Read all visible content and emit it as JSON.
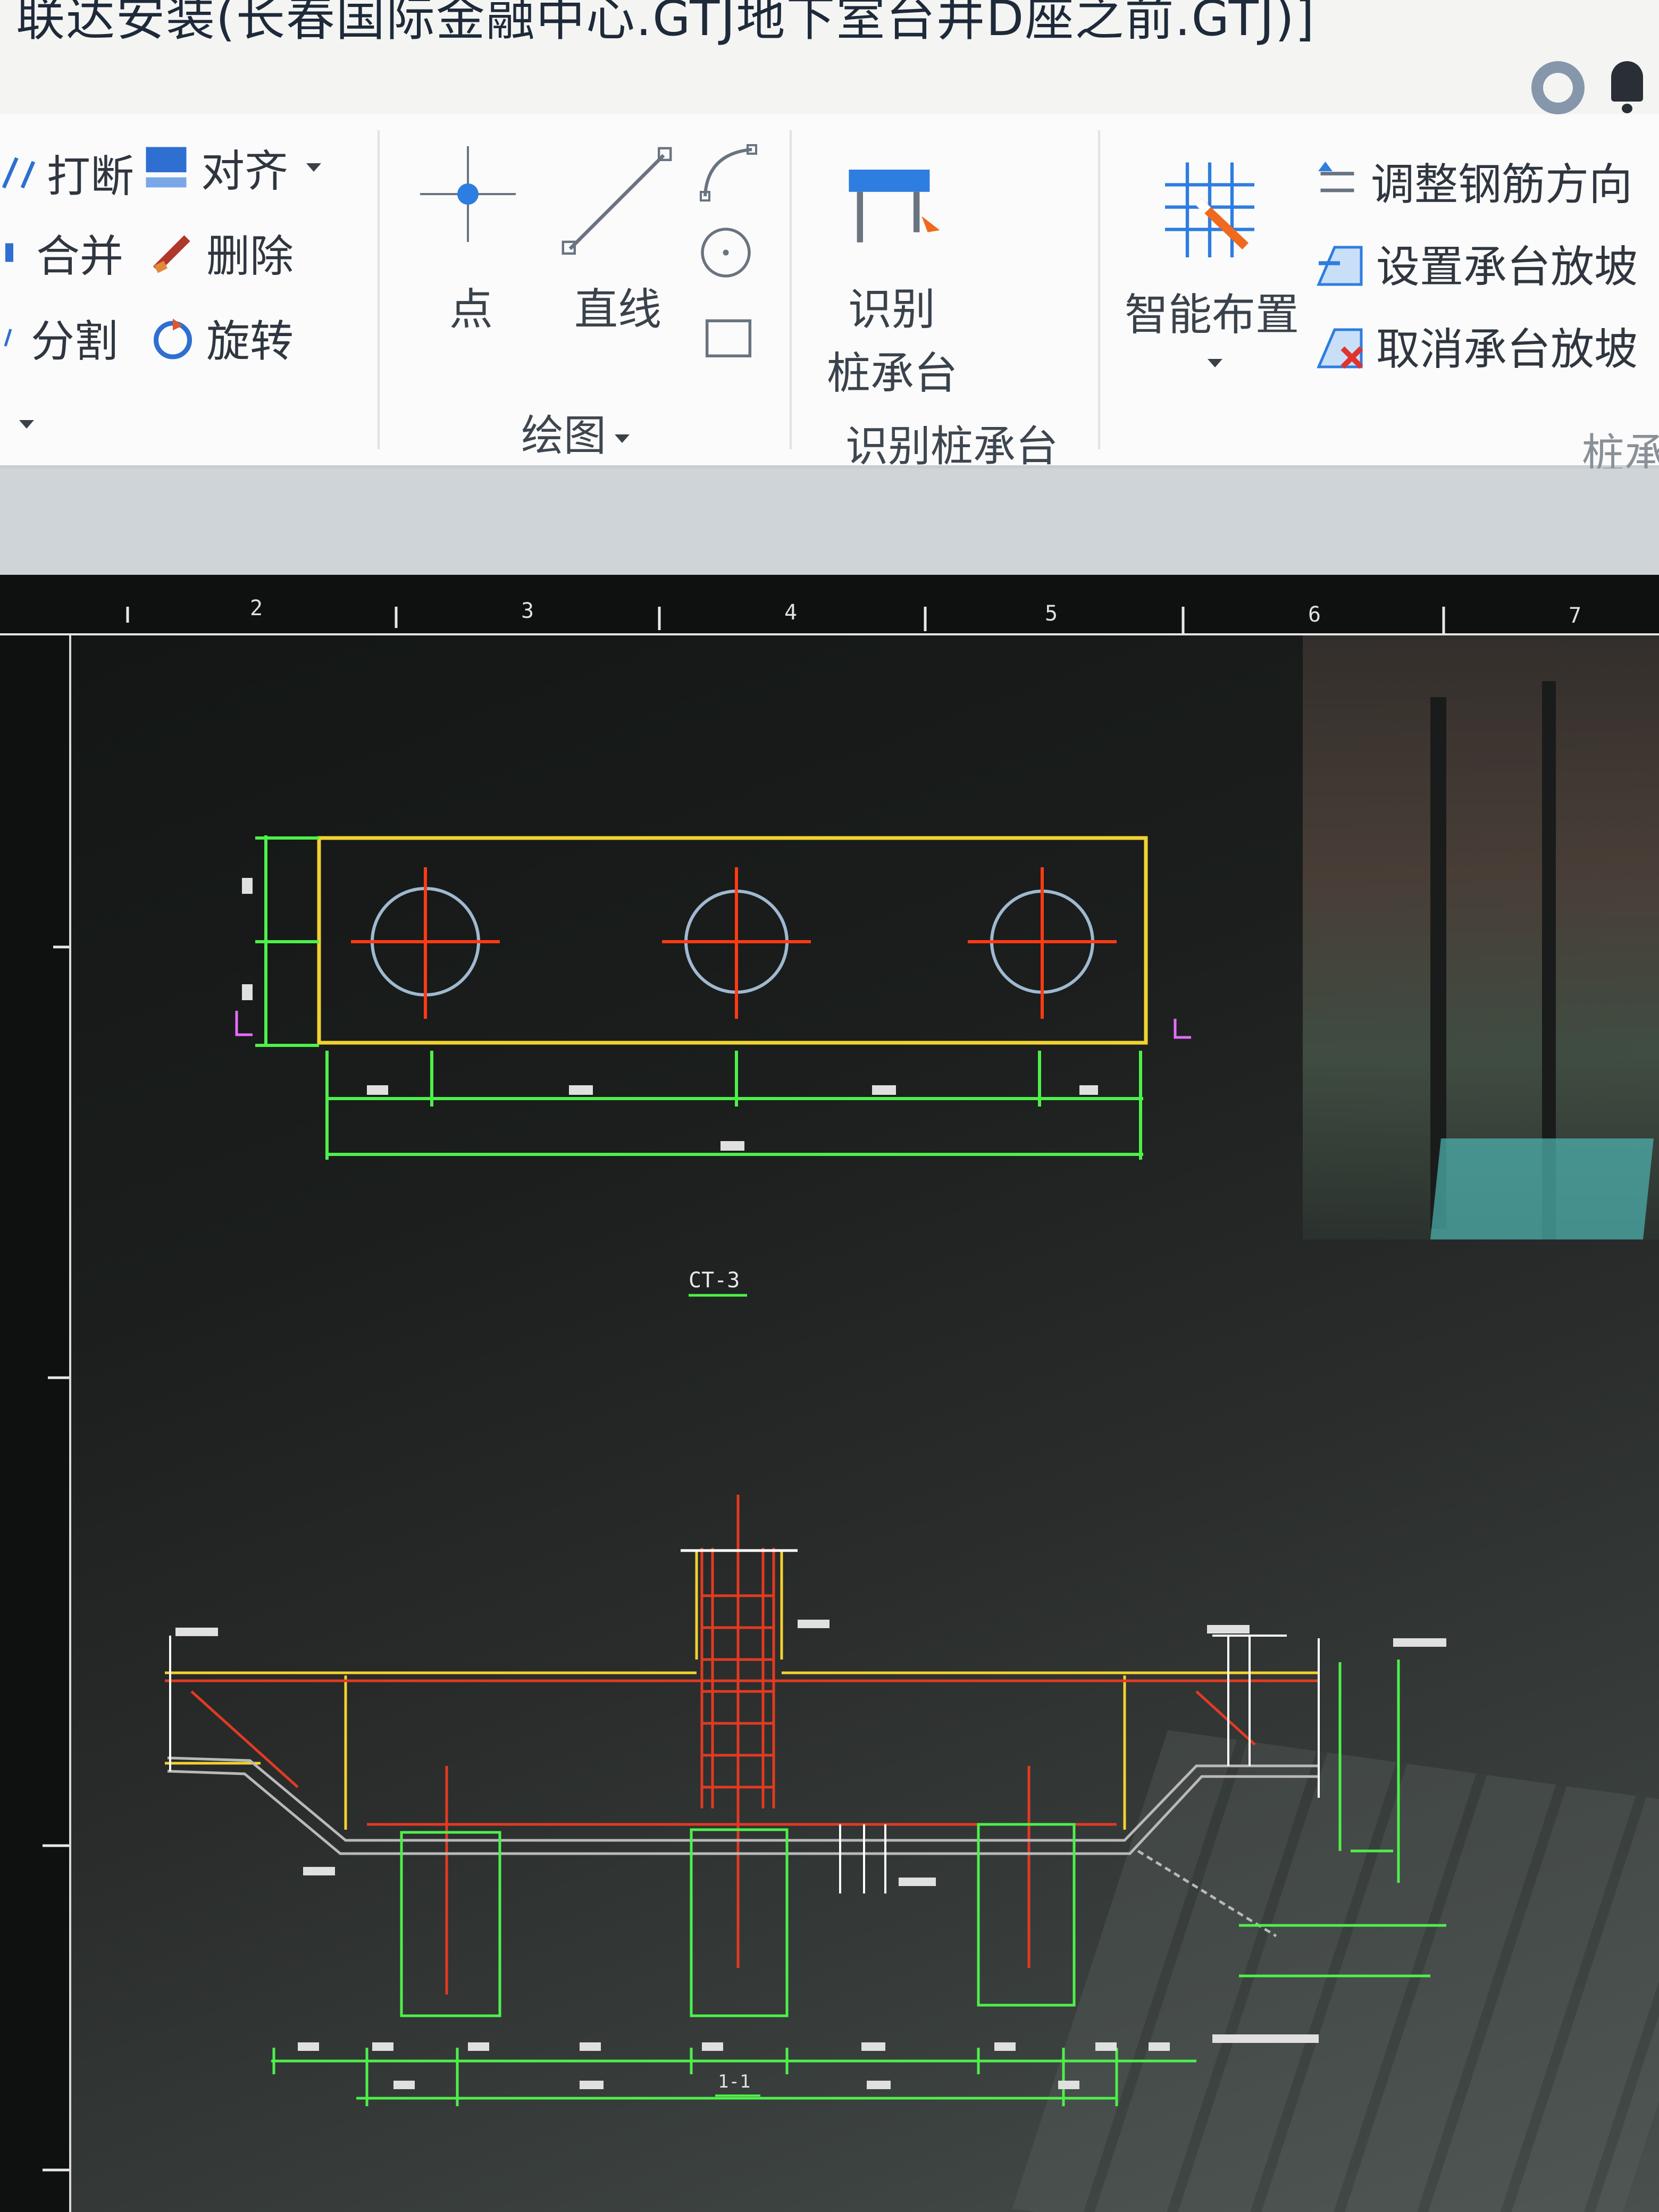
{
  "window": {
    "title": "联达安装(长春国际金融中心.GTJ地下室台井D座之前.GTJ)]"
  },
  "ribbon": {
    "modify_group": {
      "break_label": "打断",
      "merge_label": "合并",
      "split_label": "分割",
      "align_label": "对齐",
      "delete_label": "删除",
      "rotate_label": "旋转"
    },
    "draw_group": {
      "point_label": "点",
      "line_label": "直线",
      "title": "绘图"
    },
    "recognize_group": {
      "button_line1": "识别",
      "button_line2": "桩承台",
      "title": "识别桩承台"
    },
    "cap_group": {
      "smart_layout_label": "智能布置",
      "adjust_rebar_label": "调整钢筋方向",
      "set_slope_label": "设置承台放坡",
      "cancel_slope_label": "取消承台放坡",
      "title": "桩承"
    }
  },
  "drawing": {
    "ruler_top_numbers": [
      "2",
      "3",
      "4",
      "5",
      "6",
      "7"
    ],
    "section_label": "1-1",
    "plan_label": "CT-3"
  },
  "colors": {
    "cap_outline": "#f2d22e",
    "dimension": "#4ef04a",
    "pile_circle": "#9fb9cf",
    "axis_cross": "#ff3a14",
    "rebar_red": "#e23a22",
    "marker_magenta": "#e66cff"
  },
  "icons": {
    "user": "user-avatar-icon",
    "bell": "bell-icon",
    "point": "point-icon",
    "line": "line-icon",
    "arc": "arc-icon",
    "circle": "circle-icon",
    "rect": "rectangle-icon",
    "pile_cap": "pile-cap-icon",
    "smart": "smart-layout-icon"
  }
}
